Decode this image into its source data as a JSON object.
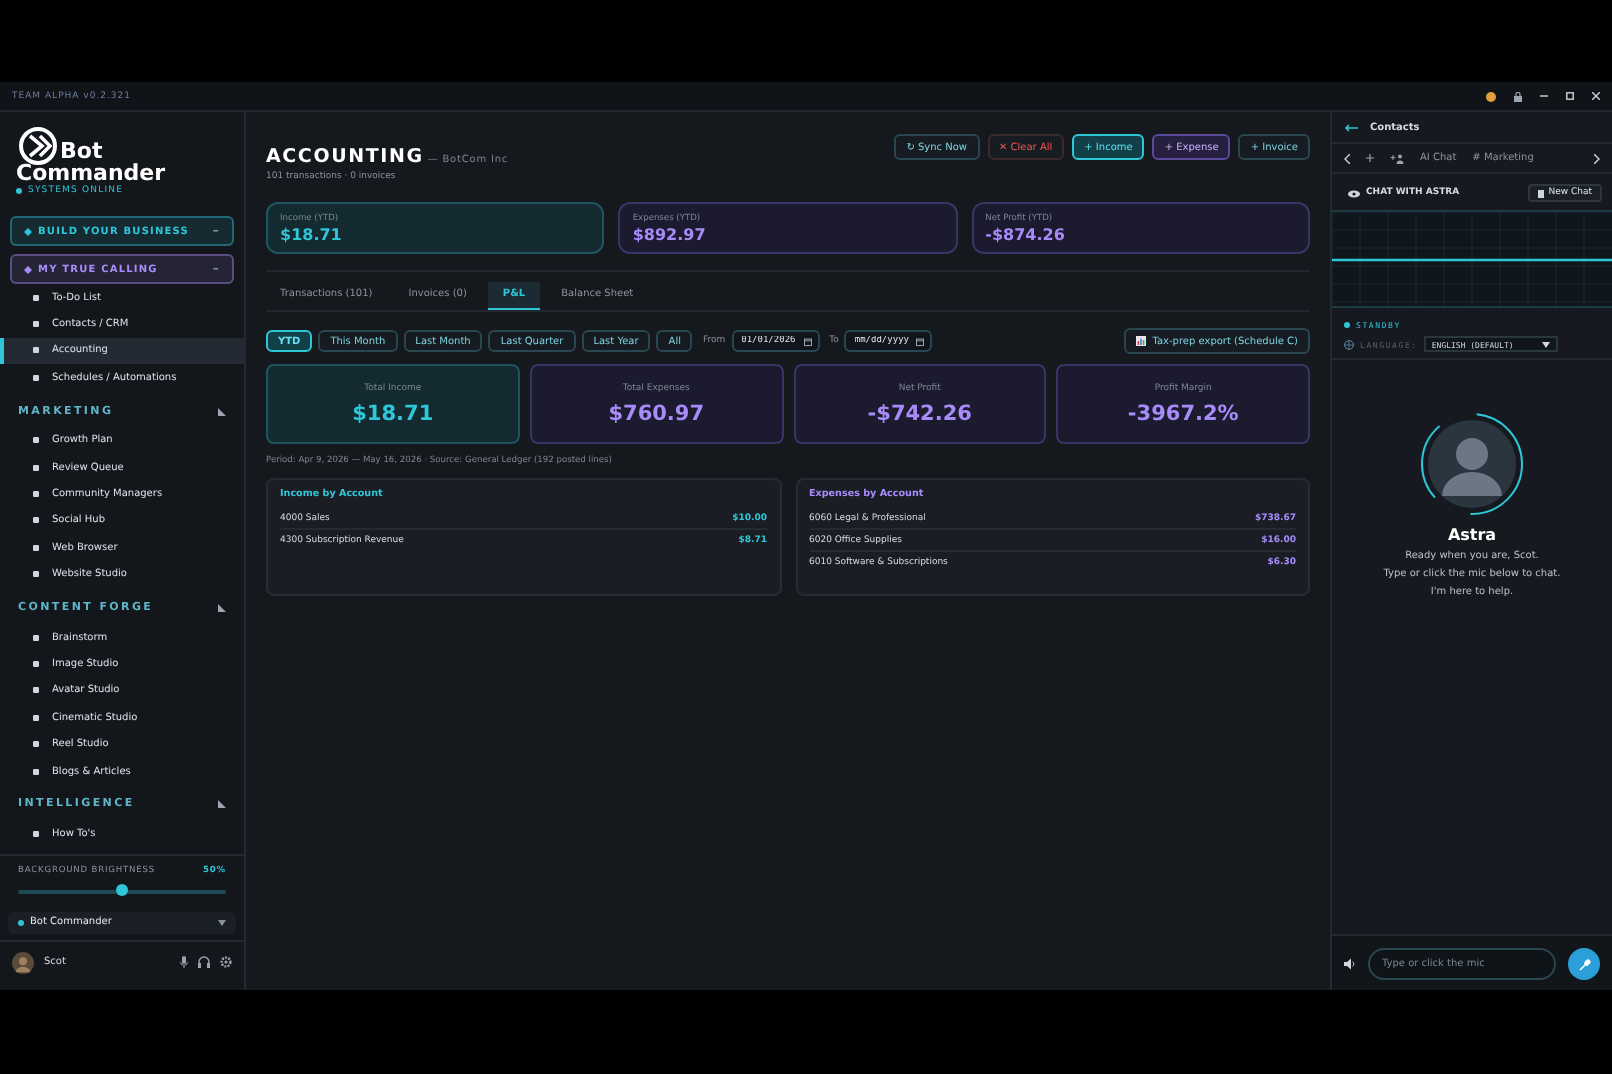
{
  "window": {
    "title": "TEAM ALPHA v0.2.321"
  },
  "sidebar": {
    "logo": {
      "line1": "Bot",
      "line2": "Commander",
      "status": "SYSTEMS ONLINE"
    },
    "groups": [
      {
        "label": "BUILD YOUR BUSINESS",
        "toggle": "–",
        "color": "#2fc6d8"
      },
      {
        "label": "MY TRUE CALLING",
        "toggle": "–",
        "color": "#a78bfa",
        "items": [
          {
            "label": "To-Do List",
            "selected": false
          },
          {
            "label": "Contacts / CRM",
            "selected": false
          },
          {
            "label": "Accounting",
            "selected": true
          },
          {
            "label": "Schedules / Automations",
            "selected": false
          }
        ]
      }
    ],
    "sections": [
      {
        "label": "MARKETING",
        "items": [
          {
            "label": "Growth Plan",
            "selected": false
          },
          {
            "label": "Review Queue",
            "selected": false
          },
          {
            "label": "Community Managers",
            "selected": false
          },
          {
            "label": "Social Hub",
            "selected": false
          },
          {
            "label": "Web Browser",
            "selected": false
          },
          {
            "label": "Website Studio",
            "selected": false
          }
        ]
      },
      {
        "label": "CONTENT FORGE",
        "items": [
          {
            "label": "Brainstorm",
            "selected": false
          },
          {
            "label": "Image Studio",
            "selected": false
          },
          {
            "label": "Avatar Studio",
            "selected": false
          },
          {
            "label": "Cinematic Studio",
            "selected": false
          },
          {
            "label": "Reel Studio",
            "selected": false
          },
          {
            "label": "Blogs & Articles",
            "selected": false
          }
        ]
      },
      {
        "label": "INTELLIGENCE",
        "items": [
          {
            "label": "How To's",
            "selected": false
          }
        ]
      }
    ],
    "brightness": {
      "label": "BACKGROUND BRIGHTNESS",
      "reading": "50%",
      "level": 0.5
    },
    "workspace": {
      "label": "Bot Commander"
    },
    "user": {
      "name": "Scot"
    }
  },
  "main": {
    "title": "ACCOUNTING",
    "company": "— BotCom Inc",
    "subtitle": "101 transactions · 0 invoices",
    "actions": [
      {
        "label": "↻ Sync Now",
        "kind": "neutral"
      },
      {
        "label": "✕ Clear All",
        "kind": "danger"
      },
      {
        "label": "+ Income",
        "kind": "teal"
      },
      {
        "label": "+ Expense",
        "kind": "purple"
      },
      {
        "label": "+ Invoice",
        "kind": "neutral"
      }
    ],
    "stats": [
      {
        "label": "Income (YTD)",
        "value": "$18.71",
        "kind": "teal"
      },
      {
        "label": "Expenses (YTD)",
        "value": "$892.97",
        "kind": "purple"
      },
      {
        "label": "Net Profit (YTD)",
        "value": "-$874.26",
        "kind": "purple"
      }
    ],
    "tabs": [
      {
        "label": "Transactions (101)",
        "selected": false
      },
      {
        "label": "Invoices (0)",
        "selected": false
      },
      {
        "label": "P&L",
        "selected": true
      },
      {
        "label": "Balance Sheet",
        "selected": false
      }
    ],
    "periods": [
      {
        "label": "YTD",
        "selected": true
      },
      {
        "label": "This Month",
        "selected": false
      },
      {
        "label": "Last Month",
        "selected": false
      },
      {
        "label": "Last Quarter",
        "selected": false
      },
      {
        "label": "Last Year",
        "selected": false
      },
      {
        "label": "All",
        "selected": false
      }
    ],
    "from": {
      "label": "From",
      "value": "01/01/2026"
    },
    "to": {
      "label": "To",
      "placeholder": "mm/dd/yyyy"
    },
    "export": {
      "label": "Tax-prep export (Schedule C)"
    },
    "summary": [
      {
        "label": "Total Income",
        "value": "$18.71",
        "kind": "teal"
      },
      {
        "label": "Total Expenses",
        "value": "$760.97",
        "kind": "purple"
      },
      {
        "label": "Net Profit",
        "value": "-$742.26",
        "kind": "purple"
      },
      {
        "label": "Profit Margin",
        "value": "-3967.2%",
        "kind": "purple"
      }
    ],
    "period_note": "Period: Apr 9, 2026 — May 16, 2026 · Source: General Ledger (192 posted lines)",
    "accounts": [
      {
        "title": "Income by Account",
        "kind": "teal",
        "rows": [
          {
            "name": "4000 Sales",
            "amount": "$10.00"
          },
          {
            "name": "4300 Subscription Revenue",
            "amount": "$8.71"
          }
        ]
      },
      {
        "title": "Expenses by Account",
        "kind": "purple",
        "rows": [
          {
            "name": "6060 Legal & Professional",
            "amount": "$738.67"
          },
          {
            "name": "6020 Office Supplies",
            "amount": "$16.00"
          },
          {
            "name": "6010 Software & Subscriptions",
            "amount": "$6.30"
          }
        ]
      }
    ]
  },
  "panel": {
    "title": "Contacts",
    "tabs": [
      {
        "label": "AI Chat",
        "selected": false
      },
      {
        "label": "# Marketing",
        "selected": false
      }
    ],
    "chat_title": "CHAT WITH ASTRA",
    "new_chat": "New Chat",
    "status": "STANDBY",
    "language_label": "LANGUAGE:",
    "language": "ENGLISH (DEFAULT)",
    "name": "Astra",
    "messages": [
      "Ready when you are, Scot.",
      "Type or click the mic below to chat.",
      "I'm here to help."
    ],
    "input": {
      "placeholder": "Type or click the mic"
    }
  }
}
